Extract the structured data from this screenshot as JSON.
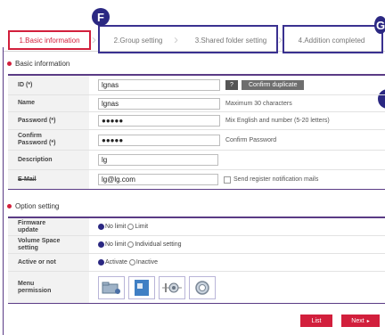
{
  "steps": [
    {
      "label": "1.Basic information"
    },
    {
      "label": "2.Group setting"
    },
    {
      "label": "3.Shared folder setting"
    },
    {
      "label": "4.Addition completed"
    }
  ],
  "callouts": {
    "f": "F",
    "g": "G"
  },
  "basic": {
    "title": "Basic information",
    "id_label": "ID (*)",
    "id_value": "lgnas",
    "dup_q": "?",
    "dup_button": "Confirm duplicate",
    "name_label": "Name",
    "name_value": "lgnas",
    "name_hint": "Maximum 30 characters",
    "password_label": "Password (*)",
    "password_value": "●●●●●",
    "password_hint": "Mix English and number (5-20 letters)",
    "confirm_label_1": "Confirm",
    "confirm_label_2": "Password (*)",
    "confirm_value": "●●●●●",
    "confirm_hint": "Confirm Password",
    "desc_label": "Description",
    "desc_value": "lg",
    "email_label": "E-Mail",
    "email_value": "lg@lg.com",
    "email_check_label": "Send register notification mails"
  },
  "option": {
    "title": "Option setting",
    "firmware_label_1": "Firmware",
    "firmware_label_2": "update",
    "firmware_opt1": "No limit",
    "firmware_opt2": "Limit",
    "volume_label_1": "Volume Space",
    "volume_label_2": "setting",
    "volume_opt1": "No limit",
    "volume_opt2": "Individual setting",
    "active_label": "Active or not",
    "active_opt1": "Activate",
    "active_opt2": "Inactive",
    "menu_label_1": "Menu",
    "menu_label_2": "permission",
    "perm_icons": [
      "folder-icon",
      "document-icon",
      "backup-icon",
      "settings-icon"
    ]
  },
  "footer": {
    "list": "List",
    "next": "Next"
  },
  "colors": {
    "accent": "#d21f3c",
    "purple": "#5a3b85",
    "navy": "#2b2882"
  }
}
